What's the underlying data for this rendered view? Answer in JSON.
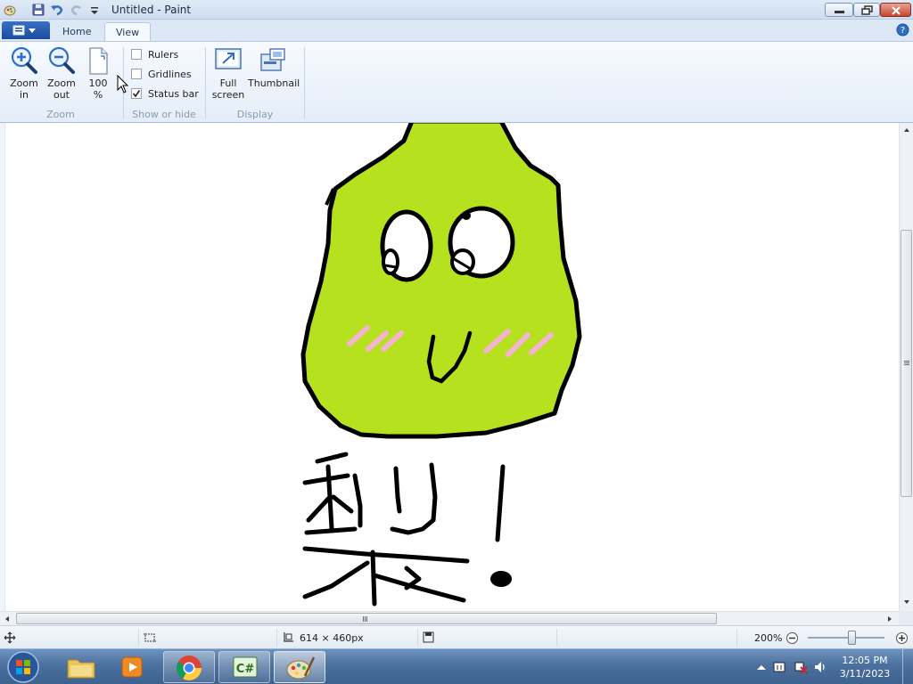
{
  "window": {
    "title": "Untitled - Paint"
  },
  "tabs": [
    {
      "label": "Home",
      "active": false
    },
    {
      "label": "View",
      "active": true
    }
  ],
  "ribbon": {
    "zoom_group": {
      "label": "Zoom",
      "zoom_in": "Zoom\nin",
      "zoom_in_1": "Zoom",
      "zoom_in_2": "in",
      "zoom_out_1": "Zoom",
      "zoom_out_2": "out",
      "hundred_1": "100",
      "hundred_2": "%"
    },
    "show_group": {
      "label": "Show or hide",
      "rulers": {
        "label": "Rulers",
        "checked": false
      },
      "gridlines": {
        "label": "Gridlines",
        "checked": false
      },
      "statusbar": {
        "label": "Status bar",
        "checked": true
      }
    },
    "display_group": {
      "label": "Display",
      "full_screen_1": "Full",
      "full_screen_2": "screen",
      "thumbnail": "Thumbnail"
    }
  },
  "status": {
    "dimensions": "614 × 460px",
    "zoom": "200%"
  },
  "taskbar": {
    "time": "12:05 PM",
    "date": "3/11/2023",
    "apps": [
      "start-orb",
      "file-explorer",
      "media-player",
      "chrome",
      "csharp-app",
      "paint"
    ]
  },
  "colors": {
    "pear_fill": "#b5e11f",
    "blush": "#f5b3d2",
    "outline": "#000000"
  }
}
